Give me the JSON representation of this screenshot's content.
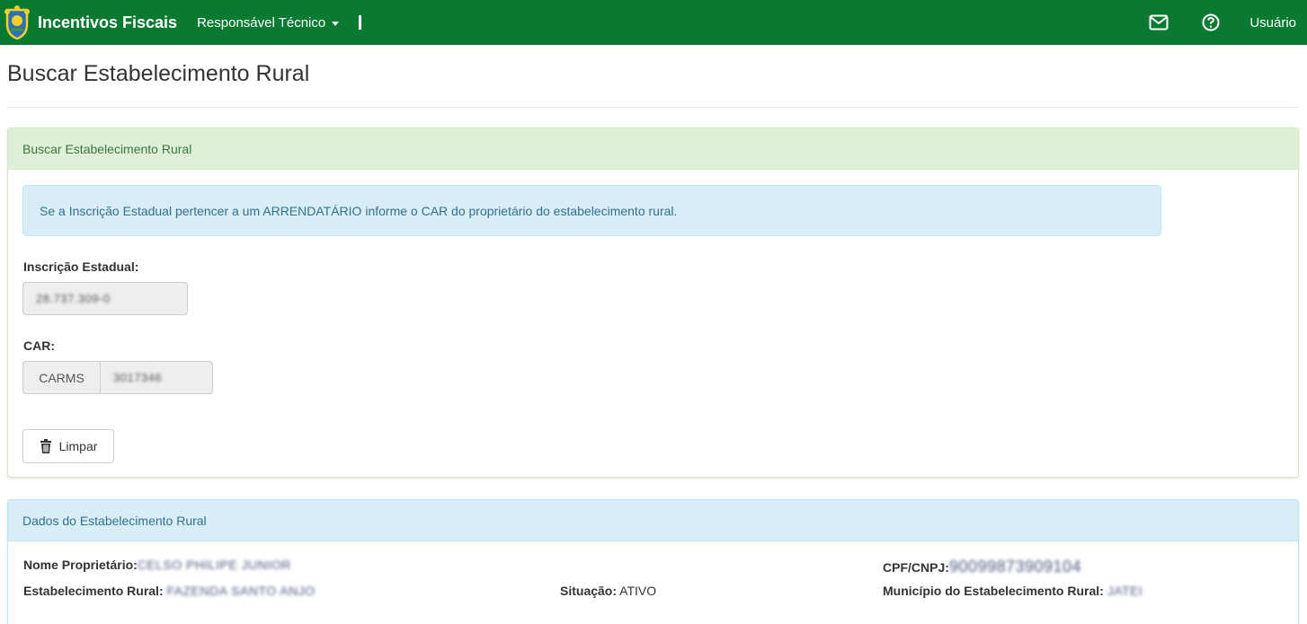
{
  "navbar": {
    "brand": "Incentivos Fiscais",
    "menu_label": "Responsável Técnico",
    "separator": "|",
    "user_label": "Usuário",
    "icons": {
      "mail": "mail-icon",
      "help": "help-icon",
      "logo": "state-coat-of-arms-logo"
    },
    "bg_color": "#0a7a32"
  },
  "page": {
    "title": "Buscar Estabelecimento Rural"
  },
  "search_panel": {
    "heading": "Buscar Estabelecimento Rural",
    "alert": "Se a Inscrição Estadual pertencer a um ARRENDATÁRIO informe o CAR do proprietário do estabelecimento rural.",
    "ie_label": "Inscrição Estadual:",
    "ie_value": "28.737.309-0",
    "car_label": "CAR:",
    "car_prefix": "CARMS",
    "car_value": "3017346",
    "clear_button": "Limpar",
    "clear_icon": "trash-icon"
  },
  "data_panel": {
    "heading": "Dados do Estabelecimento Rural",
    "owner_label": "Nome Proprietário:",
    "owner_value": "CELSO PHILIPE JUNIOR",
    "cpf_label": "CPF/CNPJ:",
    "cpf_value": "90099873909104",
    "estab_label": "Estabelecimento Rural:",
    "estab_value": "FAZENDA SANTO ANJO",
    "situacao_label": "Situação:",
    "situacao_value": "ATIVO",
    "municipio_label": "Município do Estabelecimento Rural:",
    "municipio_value": "JATEI"
  }
}
